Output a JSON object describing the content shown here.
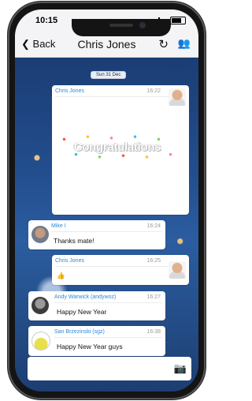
{
  "status_bar": {
    "time": "10:15"
  },
  "navbar": {
    "back_label": "Back",
    "title": "Chris Jones"
  },
  "chat": {
    "date_divider": "Sun 31 Dec",
    "messages": [
      {
        "sender": "Chris Jones",
        "time": "16:22",
        "image_text": "Congratulations"
      },
      {
        "sender": "Mike I",
        "time": "16:24",
        "text": "Thanks mate!"
      },
      {
        "sender": "Chris Jones",
        "time": "16:25",
        "text": "👍"
      },
      {
        "sender": "Andy Warwick (andywoz)",
        "time": "16:27",
        "text": "Happy New Year"
      },
      {
        "sender": "San Brzezinski (sgz)",
        "time": "16:38",
        "text": "Happy New Year guys"
      }
    ]
  },
  "composer": {
    "camera_icon": "camera-icon"
  }
}
